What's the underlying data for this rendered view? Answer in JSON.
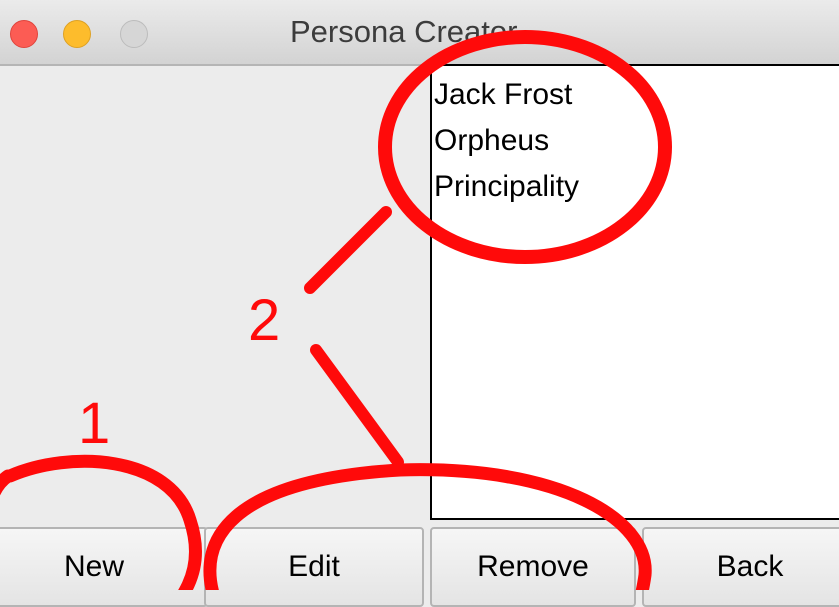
{
  "window": {
    "title": "Persona Creator"
  },
  "persona_list": {
    "items": [
      "Jack Frost",
      "Orpheus",
      "Principality"
    ]
  },
  "buttons": {
    "new_label": "New",
    "edit_label": "Edit",
    "remove_label": "Remove",
    "back_label": "Back"
  },
  "annotations": {
    "marker_1": "1",
    "marker_2": "2",
    "color": "#ff0000"
  },
  "colors": {
    "close_light": "#fc5c54",
    "minimize_light": "#fdbc2c",
    "zoom_light": "#d6d6d6"
  }
}
